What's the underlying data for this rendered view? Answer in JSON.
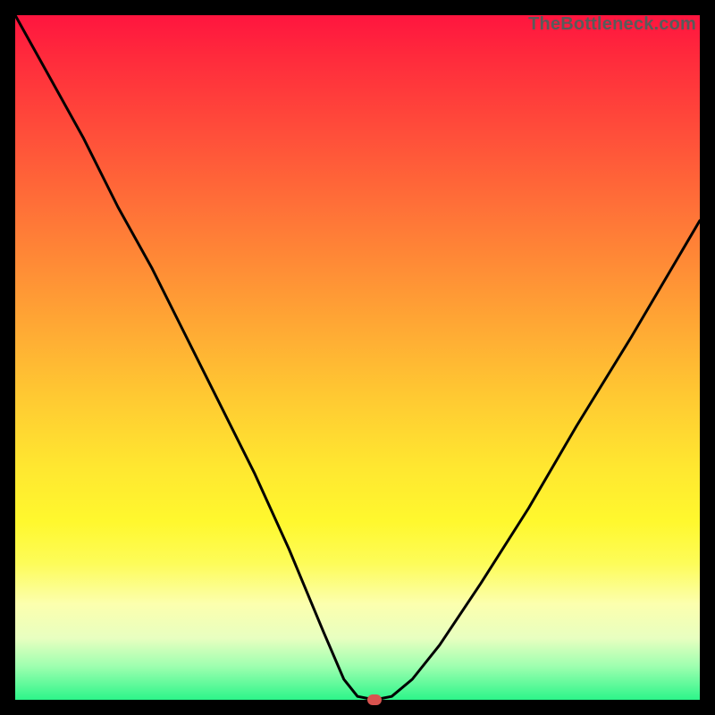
{
  "watermark": "TheBottleneck.com",
  "chart_data": {
    "type": "line",
    "title": "",
    "xlabel": "",
    "ylabel": "",
    "xlim": [
      0,
      100
    ],
    "ylim": [
      0,
      100
    ],
    "grid": false,
    "legend": false,
    "series": [
      {
        "name": "curve",
        "color": "#000000",
        "x": [
          0,
          5,
          10,
          15,
          20,
          25,
          30,
          35,
          40,
          45,
          48,
          50,
          52.5,
          55,
          58,
          62,
          68,
          75,
          82,
          90,
          100
        ],
        "y": [
          100,
          91,
          82,
          72,
          63,
          53,
          43,
          33,
          22,
          10,
          3,
          0.5,
          0,
          0.5,
          3,
          8,
          17,
          28,
          40,
          53,
          70
        ]
      }
    ],
    "marker": {
      "x": 52.5,
      "y": 0,
      "color": "#d9534f"
    },
    "background_gradient": {
      "direction": "vertical",
      "stops": [
        {
          "pos": 0,
          "color": "#ff153f"
        },
        {
          "pos": 50,
          "color": "#ffaa34"
        },
        {
          "pos": 75,
          "color": "#fff82e"
        },
        {
          "pos": 92,
          "color": "#e8ffc0"
        },
        {
          "pos": 100,
          "color": "#2cf58a"
        }
      ]
    }
  }
}
